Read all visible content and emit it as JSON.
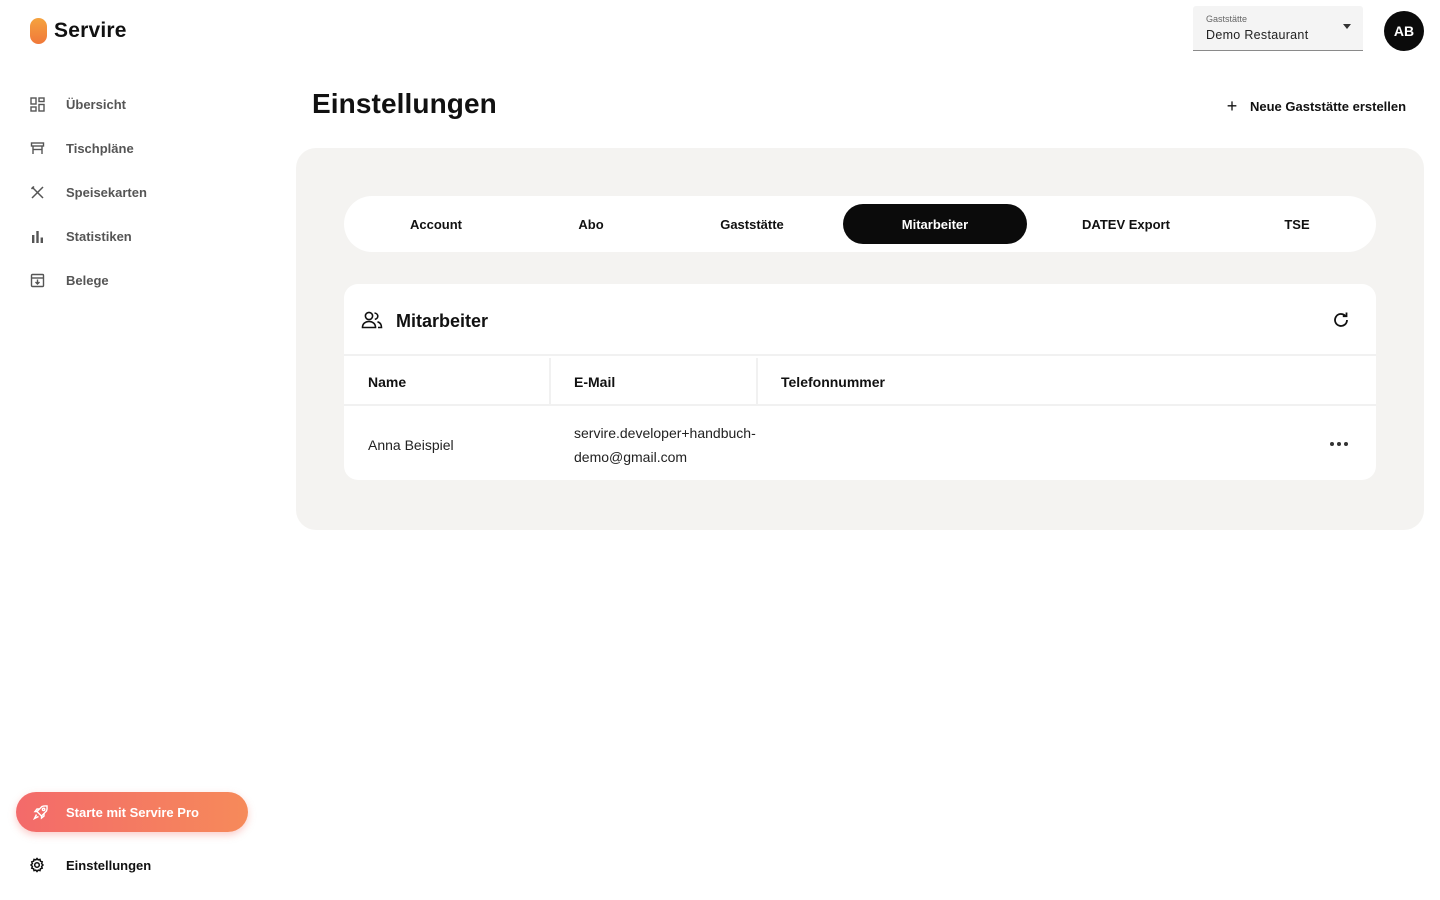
{
  "app": {
    "name": "Servire"
  },
  "venue_select": {
    "label": "Gaststätte",
    "value": "Demo Restaurant"
  },
  "user": {
    "initials": "AB"
  },
  "sidebar": {
    "items": [
      {
        "label": "Übersicht",
        "icon": "dashboard-icon"
      },
      {
        "label": "Tischpläne",
        "icon": "table-icon"
      },
      {
        "label": "Speisekarten",
        "icon": "cutlery-icon"
      },
      {
        "label": "Statistiken",
        "icon": "bar-chart-icon"
      },
      {
        "label": "Belege",
        "icon": "archive-icon"
      }
    ],
    "pro_button": "Starte mit Servire Pro",
    "settings": "Einstellungen"
  },
  "page": {
    "title": "Einstellungen",
    "new_venue": "Neue Gaststätte erstellen"
  },
  "tabs": [
    {
      "label": "Account",
      "active": false
    },
    {
      "label": "Abo",
      "active": false
    },
    {
      "label": "Gaststätte",
      "active": false
    },
    {
      "label": "Mitarbeiter",
      "active": true
    },
    {
      "label": "DATEV Export",
      "active": false
    },
    {
      "label": "TSE",
      "active": false
    }
  ],
  "staff_card": {
    "title": "Mitarbeiter",
    "columns": [
      "Name",
      "E-Mail",
      "Telefonnummer"
    ],
    "rows": [
      {
        "name": "Anna Beispiel",
        "email_line1": "servire.developer+handbuch-",
        "email_line2": "demo@gmail.com",
        "phone": ""
      }
    ]
  },
  "colors": {
    "accent": "#f0783a",
    "pro_gradient_start": "#f36a6a",
    "pro_gradient_end": "#f68a5a",
    "active_tab": "#0b0b0b",
    "panel_bg": "#f4f3f1"
  }
}
